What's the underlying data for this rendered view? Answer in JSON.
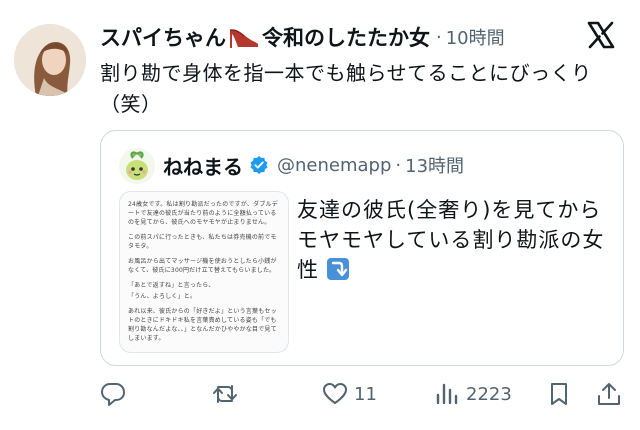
{
  "post": {
    "author_name": "スパイちゃん",
    "author_name_suffix": "令和のしたたか女",
    "time_sep": "·",
    "time": "10時間",
    "text": "割り勘で身体を指一本でも触らせてることにびっくり（笑）"
  },
  "quote": {
    "author_name": "ねねまる",
    "handle": "@nenemapp",
    "time_sep": "·",
    "time": "13時間",
    "text": "友達の彼氏(全奢り)を見てからモヤモヤしている割り勘派の女性",
    "image_paragraphs": [
      "24歳女です。私は割り勘派だったのですが、ダブルデートで友達の彼氏が当たり前のように全額払っているのを見てから、彼氏へのモヤモヤが止まりません。",
      "この前スパに行ったときも、私たちは券売機の前でモタモタ。",
      "お風呂から出てマッサージ機を使おうとしたら小銭がなくて、彼氏に300円だけ立て替えてもらいました。",
      "「あとで返すね」と言ったら、",
      "「うん、よろしく」と。",
      "あれ以来、彼氏からの「好きだよ」という言葉もセットのときにドキドキ私を言葉責めしている姿も「でも割り勘なんだよな、、」となんだかひややかな目で見てしまいます。"
    ]
  },
  "actions": {
    "likes": "11",
    "views": "2223"
  },
  "colors": {
    "text": "#0f1419",
    "secondary": "#536471",
    "border": "#cfd9de",
    "verified": "#1d9bf0",
    "arrow_emoji_bg": "#4a90d9"
  },
  "icons": [
    "x-logo-icon",
    "high-heel-icon",
    "verified-badge-icon",
    "reply-icon",
    "repost-icon",
    "like-icon",
    "views-icon",
    "bookmark-icon",
    "share-icon",
    "down-arrow-emoji-icon"
  ]
}
